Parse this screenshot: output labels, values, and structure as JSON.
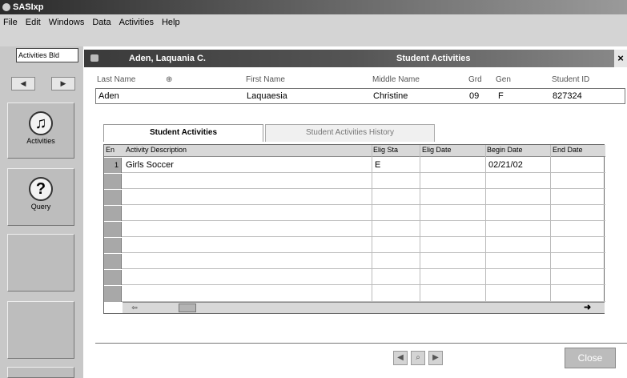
{
  "app": {
    "title": "SASIxp"
  },
  "menu": [
    "File",
    "Edit",
    "Windows",
    "Data",
    "Activities",
    "Help"
  ],
  "left_panel": {
    "combo_value": "Activities Bld",
    "buttons": [
      {
        "label": "Activities",
        "icon": "activities-icon"
      },
      {
        "label": "Query",
        "icon": "question-icon"
      }
    ]
  },
  "dialog": {
    "student_name": "Aden, Laquania C.",
    "title": "Student Activities",
    "close_glyph": "×",
    "fields": {
      "labels": {
        "last_name": "Last Name",
        "first_name": "First Name",
        "middle_name": "Middle Name",
        "grd": "Grd",
        "gen": "Gen",
        "student_id": "Student ID"
      },
      "values": {
        "last_name": "Aden",
        "first_name": "Laquaesia",
        "middle_name": "Christine",
        "grd": "09",
        "gen": "F",
        "student_id": "827324"
      }
    },
    "tabs": [
      "Student Activities",
      "Student Activities History"
    ],
    "grid": {
      "columns": [
        "En",
        "Activity Description",
        "Elig Sta",
        "Elig Date",
        "Begin Date",
        "End Date"
      ],
      "rows": [
        {
          "num": "1",
          "description": "Girls Soccer",
          "elig_status": "E",
          "elig_date": "",
          "begin_date": "02/21/02",
          "end_date": ""
        }
      ]
    },
    "close_label": "Close"
  }
}
